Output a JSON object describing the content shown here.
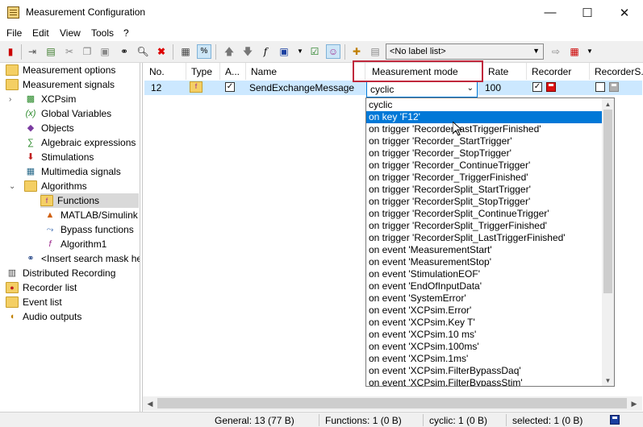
{
  "window": {
    "title": "Measurement Configuration",
    "minimize": "—",
    "maximize": "☐",
    "close": "✕"
  },
  "menu": [
    "File",
    "Edit",
    "View",
    "Tools",
    "?"
  ],
  "toolbar": {
    "label_list_value": "<No label list>",
    "icons": [
      "exit-icon",
      "import-icon",
      "export-icon",
      "cut-icon",
      "copy-icon",
      "paste-icon",
      "binoculars-icon",
      "search-icon",
      "delete-icon",
      "layout-icon",
      "percent-icon",
      "arrow-up-icon",
      "arrow-down-icon",
      "function-icon",
      "save-icon",
      "checkbox-icon",
      "user-icon",
      "label-add-icon",
      "label-remove-icon",
      "label-list-dropdown",
      "label-apply-icon",
      "label-settings-icon"
    ]
  },
  "tree": [
    {
      "label": "Measurement options",
      "icon": "folder-icon"
    },
    {
      "label": "Measurement signals",
      "icon": "folder-icon"
    },
    {
      "label": "XCPsim",
      "icon": "ecu-icon"
    },
    {
      "label": "Global Variables",
      "icon": "variable-icon"
    },
    {
      "label": "Objects",
      "icon": "objects-icon"
    },
    {
      "label": "Algebraic expressions",
      "icon": "expression-icon"
    },
    {
      "label": "Stimulations",
      "icon": "stimulation-icon"
    },
    {
      "label": "Multimedia signals",
      "icon": "multimedia-icon"
    },
    {
      "label": "Algorithms",
      "icon": "folder-icon"
    },
    {
      "label": "Functions",
      "icon": "function-folder-icon"
    },
    {
      "label": "MATLAB/Simulink",
      "icon": "matlab-icon"
    },
    {
      "label": "Bypass functions",
      "icon": "bypass-icon"
    },
    {
      "label": "Algorithm1",
      "icon": "algorithm-icon"
    },
    {
      "label": "<Insert search mask he",
      "icon": "binoculars-icon"
    },
    {
      "label": "Distributed Recording",
      "icon": "distributed-icon"
    },
    {
      "label": "Recorder list",
      "icon": "recorder-icon"
    },
    {
      "label": "Event list",
      "icon": "event-icon"
    },
    {
      "label": "Audio outputs",
      "icon": "audio-icon"
    }
  ],
  "grid": {
    "columns": [
      "No.",
      "Type",
      "A...",
      "Name",
      "Measurement mode",
      "Rate",
      "Recorder",
      "RecorderS..."
    ],
    "row": {
      "no": "12",
      "name": "SendExchangeMessage",
      "mode": "cyclic",
      "rate": "100",
      "active_checked": true,
      "recorder_checked": true,
      "recorder_s_checked": false
    }
  },
  "dropdown": {
    "options": [
      "cyclic",
      "on key 'F12'",
      "on trigger 'RecorderLastTriggerFinished'",
      "on trigger 'Recorder_StartTrigger'",
      "on trigger 'Recorder_StopTrigger'",
      "on trigger 'Recorder_ContinueTrigger'",
      "on trigger 'Recorder_TriggerFinished'",
      "on trigger 'RecorderSplit_StartTrigger'",
      "on trigger 'RecorderSplit_StopTrigger'",
      "on trigger 'RecorderSplit_ContinueTrigger'",
      "on trigger 'RecorderSplit_TriggerFinished'",
      "on trigger 'RecorderSplit_LastTriggerFinished'",
      "on event 'MeasurementStart'",
      "on event 'MeasurementStop'",
      "on event 'StimulationEOF'",
      "on event 'EndOfInputData'",
      "on event 'SystemError'",
      "on event 'XCPsim.Error'",
      "on event 'XCPsim.Key T'",
      "on event 'XCPsim.10 ms'",
      "on event 'XCPsim.100ms'",
      "on event 'XCPsim.1ms'",
      "on event 'XCPsim.FilterBypassDaq'",
      "on event 'XCPsim.FilterBypassStim'"
    ],
    "selected_option": "on key 'F12'"
  },
  "status": {
    "general": "General:  13 (77 B)",
    "functions": "Functions: 1 (0 B)",
    "cyclic": "cyclic: 1 (0 B)",
    "selected": "selected: 1 (0 B)"
  },
  "colors": {
    "selection_blue": "#0078d7",
    "row_highlight": "#cce8ff",
    "annotation_red": "#c0283c",
    "folder_yellow": "#f4cf64"
  }
}
